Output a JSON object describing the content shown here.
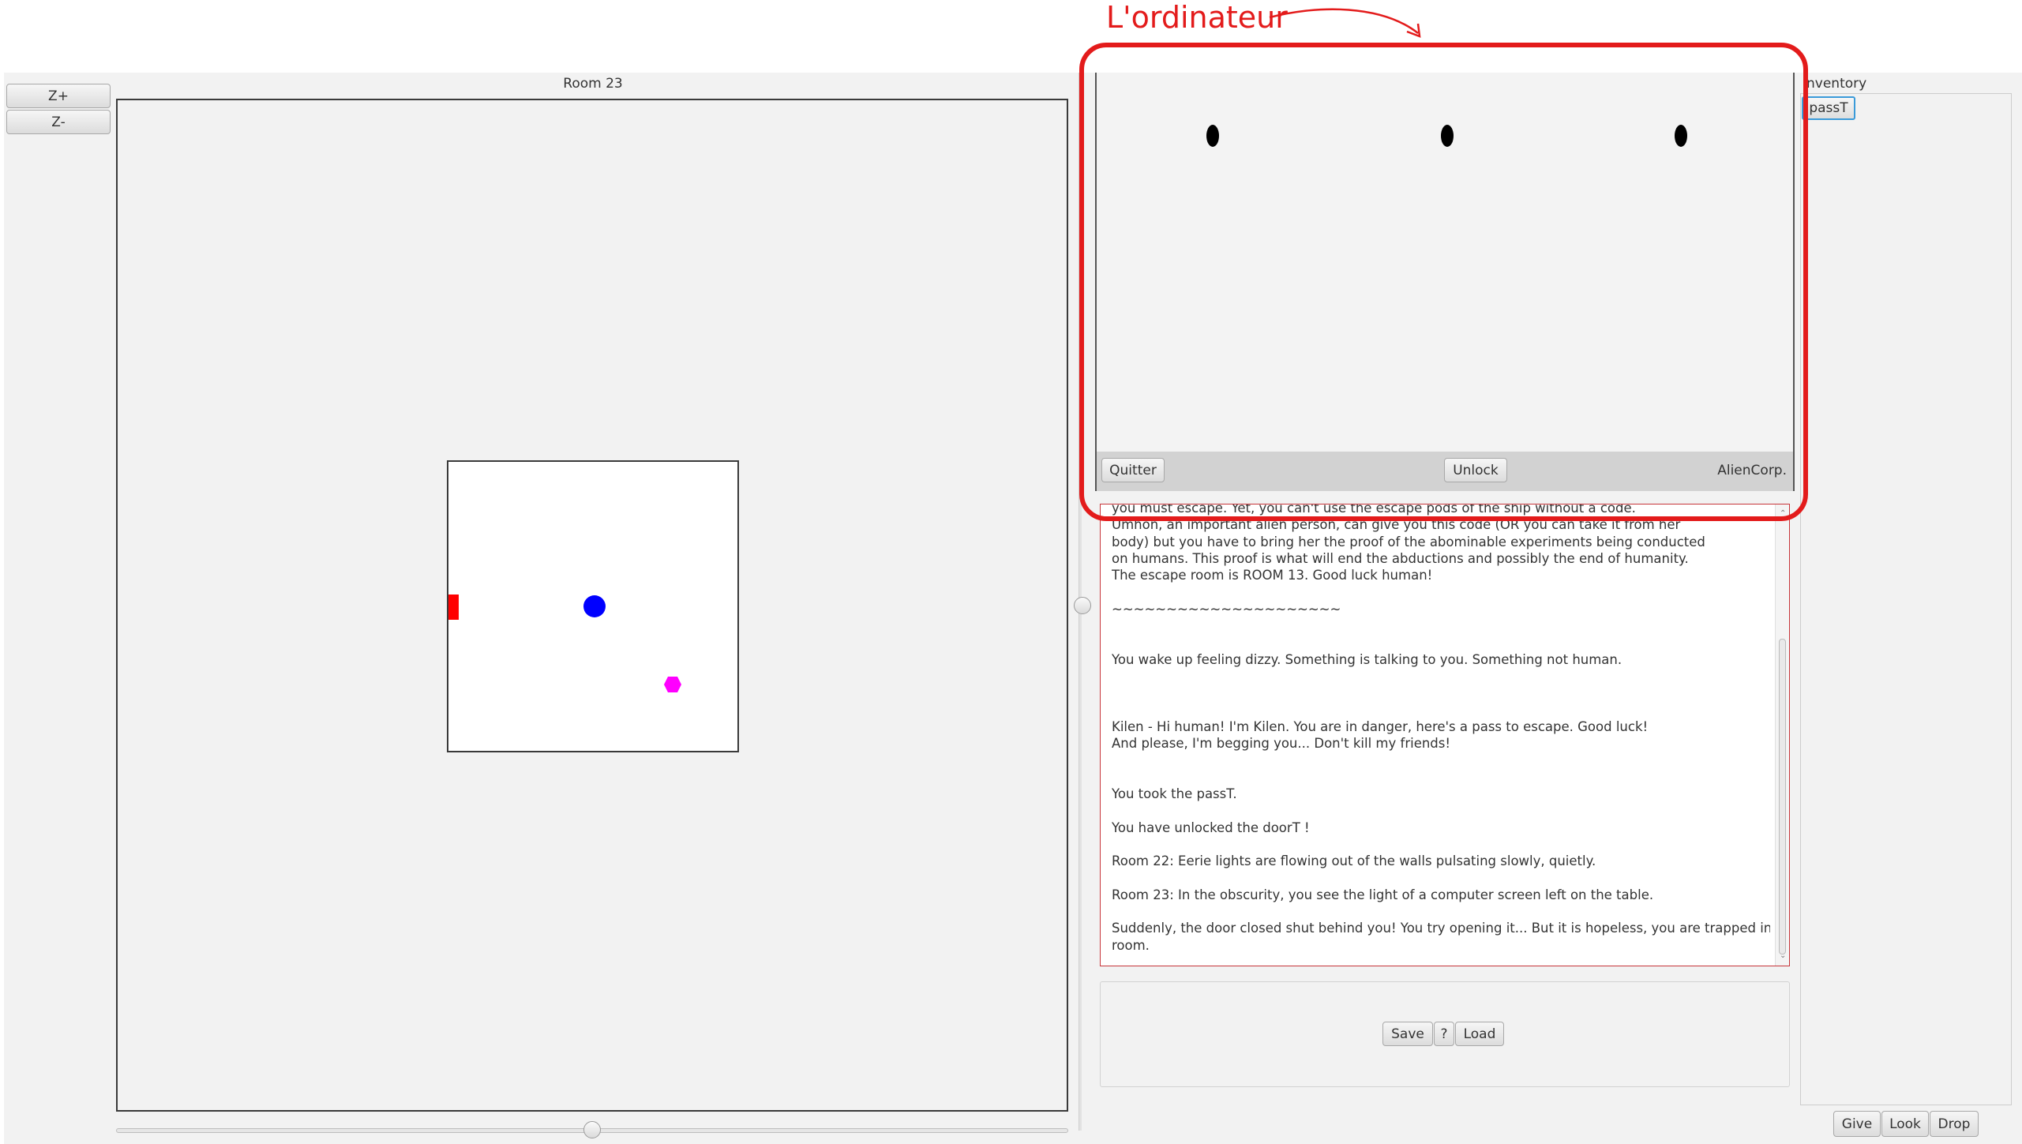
{
  "annotation": {
    "label": "L'ordinateur",
    "color": "#e31b1b"
  },
  "zoom": {
    "zoom_in_label": "Z+",
    "zoom_out_label": "Z-"
  },
  "map": {
    "room_title": "Room 23",
    "slider_value_percent": 50,
    "markers": [
      {
        "name": "door",
        "shape": "rectangle",
        "color": "#ff0000"
      },
      {
        "name": "player",
        "shape": "circle",
        "color": "#0000ff"
      },
      {
        "name": "alien",
        "shape": "hexagon",
        "color": "#ff00ff"
      }
    ]
  },
  "computer": {
    "quit_label": "Quitter",
    "unlock_label": "Unlock",
    "brand": "AlienCorp.",
    "screen_dots": 3
  },
  "log": {
    "lines": [
      "you must escape. Yet, you can't use the escape pods of the ship without a code.",
      "Umhon, an important alien person, can give you this code (OR you can take it from her",
      "body) but you have to bring her the proof of the abominable experiments being conducted",
      "on humans. This proof is what will end the abductions and possibly the end of humanity.",
      "The escape room is ROOM 13. Good luck human!",
      "",
      "~~~~~~~~~~~~~~~~~~~~~",
      "",
      "",
      "You wake up feeling dizzy. Something is talking to you. Something not human.",
      "",
      "",
      "",
      "Kilen - Hi human! I'm Kilen. You are in danger, here's a pass to escape. Good luck!",
      "And please, I'm begging you... Don't kill my friends!",
      "",
      "",
      "You took the passT.",
      "",
      "You have unlocked the doorT !",
      "",
      "Room 22: Eerie lights are flowing out of the walls pulsating slowly, quietly.",
      "",
      "Room 23: In the obscurity, you see the light of a computer screen left on the table.",
      "",
      "Suddenly, the door closed shut behind you! You try opening it... But it is hopeless, you are trapped in this",
      "room."
    ]
  },
  "save_panel": {
    "save_label": "Save",
    "help_label": "?",
    "load_label": "Load"
  },
  "inventory": {
    "title": "Inventory",
    "items": [
      "passT"
    ]
  },
  "actions": {
    "give_label": "Give",
    "look_label": "Look",
    "drop_label": "Drop"
  }
}
